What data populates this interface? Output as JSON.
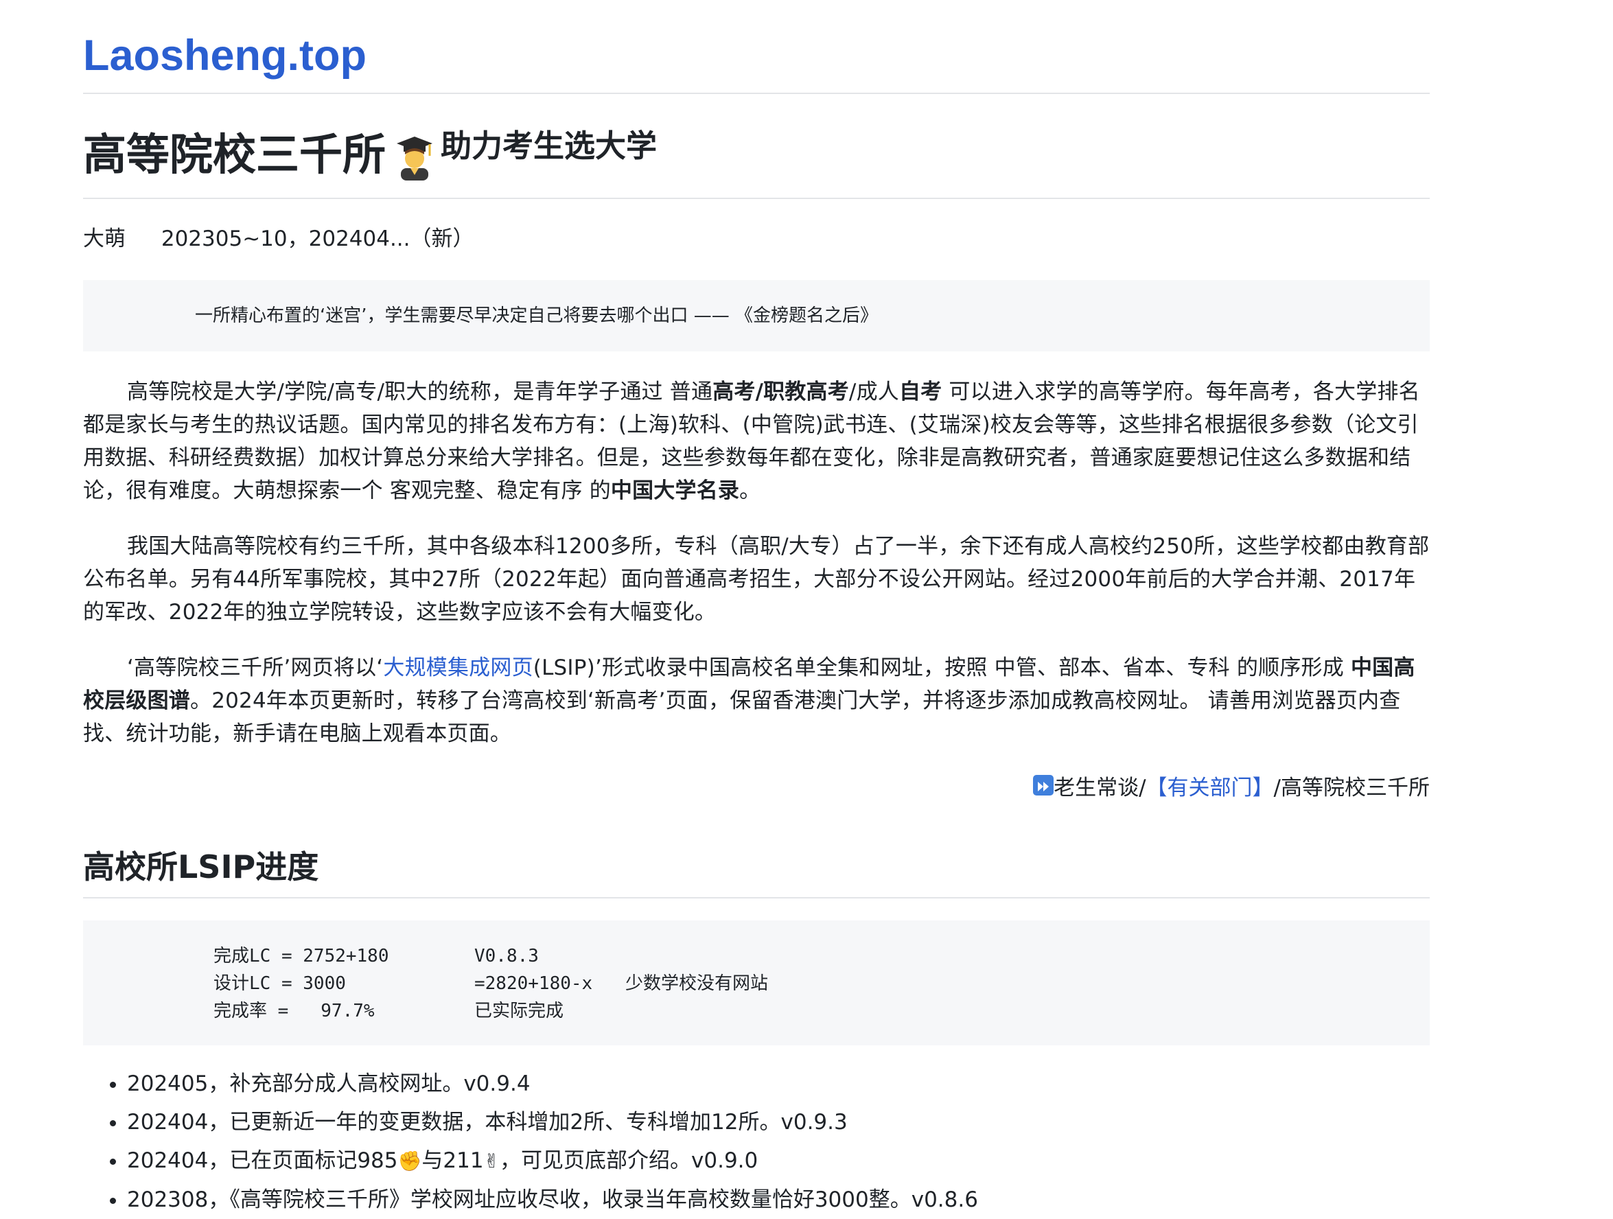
{
  "site": {
    "title": "Laosheng.top"
  },
  "heading": {
    "title": "高等院校三千所",
    "subtitle": "助力考生选大学",
    "emoji": "graduate-student"
  },
  "meta": {
    "author": "大萌",
    "dates": "202305~10，202404...（新）"
  },
  "quote": {
    "text": "一所精心布置的‘迷宫’，学生需要尽早决定自己将要去哪个出口 —— 《金榜题名之后》"
  },
  "p1": {
    "a": "高等院校是大学/学院/高专/职大的统称，是青年学子通过 普通",
    "b1": "高考/职教高考",
    "c": "/成人",
    "b2": "自考",
    "d": " 可以进入求学的高等学府。每年高考，各大学排名都是家长与考生的热议话题。国内常见的排名发布方有：(上海)软科、(中管院)武书连、(艾瑞深)校友会等等，这些排名根据很多参数（论文引用数据、科研经费数据）加权计算总分来给大学排名。但是，这些参数每年都在变化，除非是高教研究者，普通家庭要想记住这么多数据和结论，很有难度。大萌想探索一个 客观完整、稳定有序 的",
    "b3": "中国大学名录",
    "e": "。"
  },
  "p2": {
    "text": "我国大陆高等院校有约三千所，其中各级本科1200多所，专科（高职/大专）占了一半，余下还有成人高校约250所，这些学校都由教育部公布名单。另有44所军事院校，其中27所（2022年起）面向普通高考招生，大部分不设公开网站。经过2000年前后的大学合并潮、2017年的军改、2022年的独立学院转设，这些数字应该不会有大幅变化。"
  },
  "p3": {
    "a": "‘高等院校三千所’网页将以‘",
    "link": "大规模集成网页",
    "b": "(LSIP)’形式收录中国高校名单全集和网址，按照 中管、部本、省本、专科 的顺序形成 ",
    "bold": "中国高校层级图谱",
    "c": "。2024年本页更新时，转移了台湾高校到‘新高考’页面，保留香港澳门大学，并将逐步添加成教高校网址。 请善用浏览器页内查找、统计功能，新手请在电脑上观看本页面。"
  },
  "crumbs": {
    "icon": "fast-forward-icon",
    "a": "老生常谈/",
    "link": "【有关部门】",
    "b": "/高等院校三千所"
  },
  "section": {
    "title": "高校所LSIP进度"
  },
  "code": {
    "rows": [
      {
        "c1": "完成LC = 2752+180",
        "c2": "V0.8.3",
        "c3": ""
      },
      {
        "c1": "设计LC = 3000",
        "c2": "=2820+180-x",
        "c3": "少数学校没有网站"
      },
      {
        "c1": "完成率 =   97.7%",
        "c2": "已实际完成",
        "c3": ""
      }
    ]
  },
  "changes": {
    "items": [
      {
        "text": "202405，补充部分成人高校网址。v0.9.4"
      },
      {
        "text": "202404，已更新近一年的变更数据，本科增加2所、专科增加12所。v0.9.3"
      },
      {
        "a": "202404，已在页面标记985",
        "e1": "✊",
        "b": "与211",
        "e2": "✌",
        "c": "，可见页底部介绍。v0.9.0"
      },
      {
        "text": "202308，《高等院校三千所》学校网址应收尽收，收录当年高校数量恰好3000整。v0.8.6"
      }
    ]
  }
}
